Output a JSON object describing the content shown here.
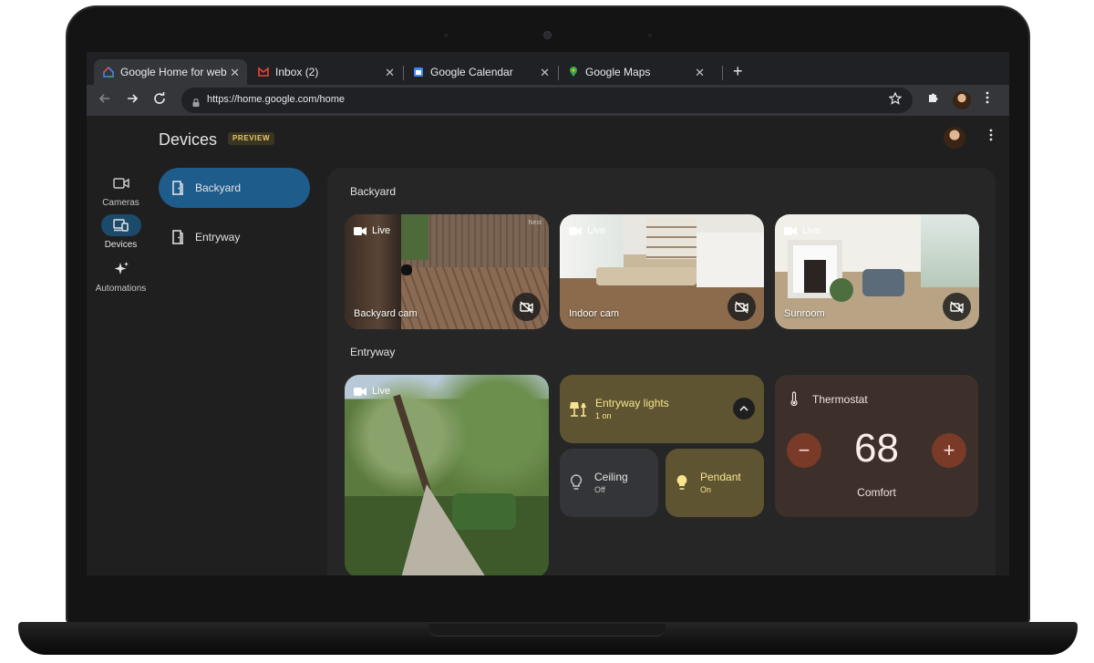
{
  "browser": {
    "tabs": [
      {
        "title": "Google Home for web",
        "active": true
      },
      {
        "title": "Inbox (2)",
        "active": false
      },
      {
        "title": "Google Calendar",
        "active": false
      },
      {
        "title": "Google Maps",
        "active": false
      }
    ],
    "close_glyph": "✕",
    "new_tab_glyph": "+",
    "url": "https://home.google.com/home"
  },
  "app": {
    "page_title": "Devices",
    "badge": "PREVIEW",
    "rail": [
      {
        "label": "Cameras",
        "icon": "camera-icon",
        "active": false
      },
      {
        "label": "Devices",
        "icon": "devices-icon",
        "active": true
      },
      {
        "label": "Automations",
        "icon": "sparkle-icon",
        "active": false
      }
    ],
    "rooms": [
      {
        "label": "Backyard",
        "active": true
      },
      {
        "label": "Entryway",
        "active": false
      }
    ]
  },
  "sections": {
    "backyard": {
      "title": "Backyard",
      "cameras": [
        {
          "name": "Backyard cam",
          "status": "Live",
          "brand": "Nest"
        },
        {
          "name": "Indoor cam",
          "status": "Live"
        },
        {
          "name": "Sunroom",
          "status": "Live"
        }
      ]
    },
    "entryway": {
      "title": "Entryway",
      "camera": {
        "status": "Live"
      },
      "lights": {
        "name": "Entryway lights",
        "state": "1 on"
      },
      "ceiling": {
        "name": "Ceiling",
        "state": "Off"
      },
      "pendant": {
        "name": "Pendant",
        "state": "On"
      },
      "thermostat": {
        "name": "Thermostat",
        "temperature": "68",
        "mode": "Comfort",
        "minus": "−",
        "plus": "+"
      }
    }
  },
  "colors": {
    "accent_blue": "#1e5c8c",
    "light_tile": "#5e5432",
    "thermostat_tile": "#3d302b",
    "light_text": "#f6e58d"
  }
}
